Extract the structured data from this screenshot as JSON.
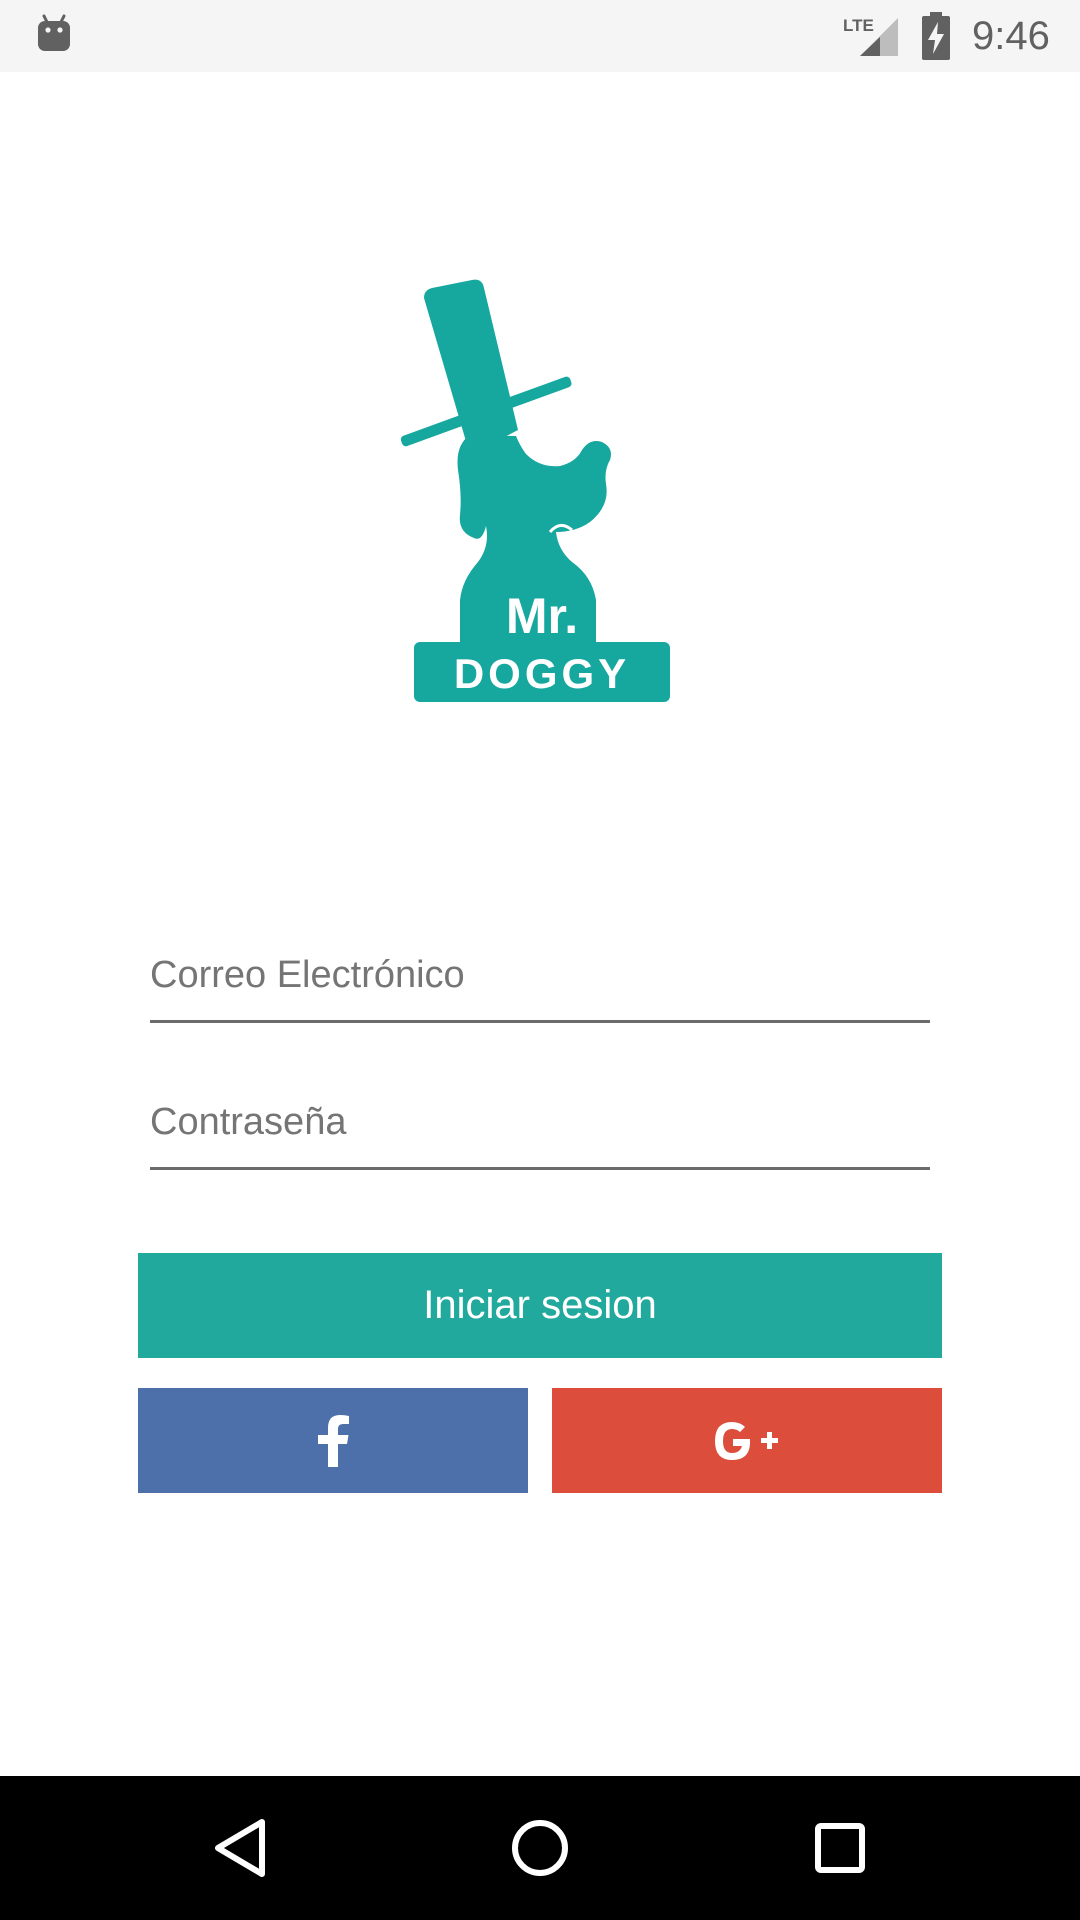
{
  "status_bar": {
    "time": "9:46",
    "network": "LTE",
    "icons": [
      "android-icon",
      "lte-signal-icon",
      "battery-charging-icon"
    ]
  },
  "logo": {
    "line1": "Mr.",
    "line2": "DOGGY",
    "color": "#16a79f"
  },
  "form": {
    "email_placeholder": "Correo Electrónico",
    "password_placeholder": "Contraseña"
  },
  "buttons": {
    "login_label": "Iniciar sesion",
    "facebook_icon": "facebook-icon",
    "google_icon": "google-plus-icon"
  },
  "colors": {
    "accent": "#22a99d",
    "facebook": "#4d6faa",
    "google": "#dc4e3b"
  },
  "nav_bar": {
    "icons": [
      "back-icon",
      "home-icon",
      "recents-icon"
    ]
  }
}
